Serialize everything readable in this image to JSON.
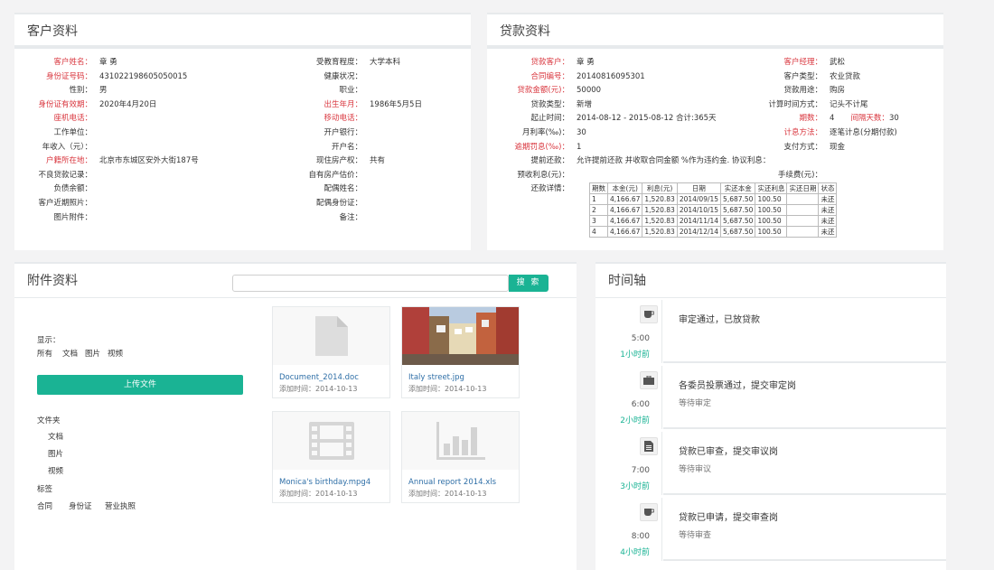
{
  "customer": {
    "title": "客户资料",
    "left": [
      {
        "label": "客户姓名：",
        "value": "章 勇",
        "red": true
      },
      {
        "label": "身份证号码：",
        "value": "431022198605050015",
        "red": true
      },
      {
        "label": "性别：",
        "value": "男",
        "red": false
      },
      {
        "label": "身份证有效期：",
        "value": "2020年4月20日",
        "red": true
      },
      {
        "label": "座机电话：",
        "value": "",
        "red": true
      },
      {
        "label": "工作单位：",
        "value": "",
        "red": false
      },
      {
        "label": "年收入（元）：",
        "value": "",
        "red": false
      },
      {
        "label": "户籍所在地：",
        "value": "北京市东城区安外大街187号",
        "red": true
      },
      {
        "label": "不良贷款记录：",
        "value": "",
        "red": false
      },
      {
        "label": "负债余额：",
        "value": "",
        "red": false
      },
      {
        "label": "客户近期照片：",
        "value": "",
        "red": false
      },
      {
        "label": "图片附件：",
        "value": "",
        "red": false
      }
    ],
    "right": [
      {
        "label": "受教育程度：",
        "value": "大学本科",
        "red": false
      },
      {
        "label": "健康状况：",
        "value": "",
        "red": false
      },
      {
        "label": "职业：",
        "value": "",
        "red": false
      },
      {
        "label": "出生年月：",
        "value": "1986年5月5日",
        "red": true
      },
      {
        "label": "移动电话：",
        "value": "",
        "red": true
      },
      {
        "label": "开户银行：",
        "value": "",
        "red": false
      },
      {
        "label": "开户名：",
        "value": "",
        "red": false
      },
      {
        "label": "现住房产权：",
        "value": "共有",
        "red": false
      },
      {
        "label": "自有房产估价：",
        "value": "",
        "red": false
      },
      {
        "label": "配偶姓名：",
        "value": "",
        "red": false
      },
      {
        "label": "配偶身份证：",
        "value": "",
        "red": false
      },
      {
        "label": "备注：",
        "value": "",
        "red": false
      }
    ]
  },
  "loan": {
    "title": "贷款资料",
    "left": [
      {
        "label": "贷款客户：",
        "value": "章 勇",
        "red": true
      },
      {
        "label": "合同编号：",
        "value": "20140816095301",
        "red": true
      },
      {
        "label": "贷款金额(元)：",
        "value": "50000",
        "red": true
      },
      {
        "label": "贷款类型：",
        "value": "新增",
        "red": false
      },
      {
        "label": "起止时间：",
        "value": "2014-08-12    -  2015-08-12    合计:365天",
        "red": false
      },
      {
        "label": "月利率(‰)：",
        "value": "30",
        "red": false
      },
      {
        "label": "逾期罚息(‰)：",
        "value": "1",
        "red": true
      },
      {
        "label": "提前还款：",
        "value": "允许提前还款    并收取合同金额              %作为违约金.    协议利息：",
        "red": false
      },
      {
        "label": "预收利息(元)：",
        "value": "",
        "red": false
      },
      {
        "label": "还款详情：",
        "value": "",
        "red": false
      }
    ],
    "right": [
      {
        "label": "客户经理：",
        "value": "武松",
        "red": true
      },
      {
        "label": "客户类型：",
        "value": "农业贷款",
        "red": false
      },
      {
        "label": "贷款用途：",
        "value": "购房",
        "red": false
      },
      {
        "label": "计算时间方式：",
        "value": "记头不计尾",
        "red": false
      },
      {
        "label": "期数：",
        "value": "4",
        "red": true,
        "extra_label": "间隔天数：",
        "extra_value": "30"
      },
      {
        "label": "计息方法：",
        "value": "逐笔计息(分期付款)",
        "red": true
      },
      {
        "label": "支付方式：",
        "value": "现金",
        "red": false
      },
      {
        "label": "",
        "value": "",
        "red": false
      },
      {
        "label": "手续费(元)：",
        "value": "",
        "red": false
      }
    ],
    "table": {
      "headers": [
        "期数",
        "本金(元)",
        "利息(元)",
        "日期",
        "实还本金",
        "实还利息",
        "实还日期",
        "状态"
      ],
      "rows": [
        [
          "1",
          "4,166.67",
          "1,520.83",
          "2014/09/15",
          "5,687.50",
          "100.50",
          "",
          "未还"
        ],
        [
          "2",
          "4,166.67",
          "1,520.83",
          "2014/10/15",
          "5,687.50",
          "100.50",
          "",
          "未还"
        ],
        [
          "3",
          "4,166.67",
          "1,520.83",
          "2014/11/14",
          "5,687.50",
          "100.50",
          "",
          "未还"
        ],
        [
          "4",
          "4,166.67",
          "1,520.83",
          "2014/12/14",
          "5,687.50",
          "100.50",
          "",
          "未还"
        ]
      ]
    }
  },
  "attachments": {
    "title": "附件资料",
    "search_placeholder": "",
    "search_button": "搜 索",
    "display_label": "显示：",
    "filters": [
      "所有",
      "文档",
      "图片",
      "视频"
    ],
    "upload_button": "上传文件",
    "folder_label": "文件夹",
    "folders": [
      "文档",
      "图片",
      "视频"
    ],
    "tag_label": "标签",
    "tags": [
      "合同",
      "身份证",
      "营业执照"
    ],
    "files": [
      {
        "name": "Document_2014.doc",
        "date": "添加时间：2014-10-13",
        "icon": "document-icon"
      },
      {
        "name": "Italy street.jpg",
        "date": "添加时间：2014-10-13",
        "icon": "photo-thumbnail"
      },
      {
        "name": "Monica's birthday.mpg4",
        "date": "添加时间：2014-10-13",
        "icon": "film-icon"
      },
      {
        "name": "Annual report 2014.xls",
        "date": "添加时间：2014-10-13",
        "icon": "bar-chart-icon"
      }
    ]
  },
  "timeline": {
    "title": "时间轴",
    "items": [
      {
        "icon": "coffee-icon",
        "time": "5:00",
        "ago": "1小时前",
        "title": "审定通过，已放贷款",
        "sub": ""
      },
      {
        "icon": "briefcase-icon",
        "time": "6:00",
        "ago": "2小时前",
        "title": "各委员投票通过，提交审定岗",
        "sub": "等待审定"
      },
      {
        "icon": "file-icon",
        "time": "7:00",
        "ago": "3小时前",
        "title": "贷款已审查，提交审议岗",
        "sub": "等待审议"
      },
      {
        "icon": "coffee-icon",
        "time": "8:00",
        "ago": "4小时前",
        "title": "贷款已申请，提交审查岗",
        "sub": "等待审查"
      }
    ]
  },
  "colors": {
    "accent": "#1ab394",
    "required": "#d9363e",
    "link": "#2f6fa7"
  }
}
